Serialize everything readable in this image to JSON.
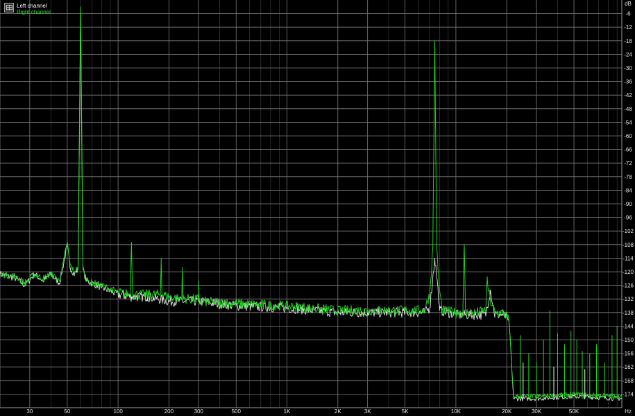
{
  "chart_data": {
    "type": "line",
    "x_scale": "log",
    "xlim_hz": [
      20,
      96000
    ],
    "ylim_db": [
      -180,
      0
    ],
    "grid": true,
    "x_unit_label": "Hz",
    "y_unit_label": "dB",
    "x_ticks": [
      {
        "value": 20,
        "label": ""
      },
      {
        "value": 30,
        "label": "30"
      },
      {
        "value": 50,
        "label": "50"
      },
      {
        "value": 100,
        "label": "100"
      },
      {
        "value": 200,
        "label": "200"
      },
      {
        "value": 300,
        "label": "300"
      },
      {
        "value": 500,
        "label": "500"
      },
      {
        "value": 1000,
        "label": "1K"
      },
      {
        "value": 2000,
        "label": "2K"
      },
      {
        "value": 3000,
        "label": "3K"
      },
      {
        "value": 5000,
        "label": "5K"
      },
      {
        "value": 10000,
        "label": "10K"
      },
      {
        "value": 20000,
        "label": "20K"
      },
      {
        "value": 30000,
        "label": "30K"
      },
      {
        "value": 50000,
        "label": "50K"
      }
    ],
    "x_minor_ticks": [
      40,
      60,
      70,
      80,
      90,
      400,
      600,
      700,
      800,
      900,
      4000,
      6000,
      7000,
      8000,
      9000,
      40000,
      60000,
      70000,
      80000,
      90000
    ],
    "y_ticks": [
      -6,
      -12,
      -18,
      -24,
      -30,
      -36,
      -42,
      -48,
      -54,
      -60,
      -66,
      -72,
      -78,
      -84,
      -90,
      -96,
      -102,
      -108,
      -114,
      -120,
      -126,
      -132,
      -138,
      -144,
      -150,
      -156,
      -162,
      -168,
      -174
    ],
    "series": [
      {
        "name": "Left channel",
        "color": "#ffffff",
        "points": [
          [
            20,
            -121
          ],
          [
            25,
            -123
          ],
          [
            28,
            -126
          ],
          [
            32,
            -121
          ],
          [
            36,
            -124
          ],
          [
            40,
            -121
          ],
          [
            45,
            -125
          ],
          [
            48,
            -115
          ],
          [
            50,
            -108
          ],
          [
            52,
            -118
          ],
          [
            55,
            -121
          ],
          [
            58,
            -119
          ],
          [
            60,
            -6
          ],
          [
            62,
            -119
          ],
          [
            65,
            -124
          ],
          [
            80,
            -127
          ],
          [
            100,
            -130
          ],
          [
            120,
            -131
          ],
          [
            150,
            -131
          ],
          [
            200,
            -133
          ],
          [
            300,
            -133
          ],
          [
            500,
            -135
          ],
          [
            1000,
            -136
          ],
          [
            2000,
            -138
          ],
          [
            3000,
            -138
          ],
          [
            5000,
            -138
          ],
          [
            6500,
            -138
          ],
          [
            7000,
            -136
          ],
          [
            7500,
            -114
          ],
          [
            7800,
            -126
          ],
          [
            8000,
            -137
          ],
          [
            10000,
            -139
          ],
          [
            13000,
            -139
          ],
          [
            15000,
            -139
          ],
          [
            16000,
            -128
          ],
          [
            17000,
            -139
          ],
          [
            19000,
            -139
          ],
          [
            20500,
            -141
          ],
          [
            21000,
            -150
          ],
          [
            21500,
            -165
          ],
          [
            22000,
            -176
          ],
          [
            30000,
            -176
          ],
          [
            50000,
            -175
          ],
          [
            96000,
            -176
          ]
        ]
      },
      {
        "name": "Right channel",
        "color": "#22dd22",
        "points": [
          [
            20,
            -121
          ],
          [
            25,
            -122
          ],
          [
            28,
            -125
          ],
          [
            32,
            -121
          ],
          [
            36,
            -123
          ],
          [
            40,
            -121
          ],
          [
            45,
            -124
          ],
          [
            48,
            -114
          ],
          [
            50,
            -107
          ],
          [
            52,
            -117
          ],
          [
            55,
            -120
          ],
          [
            58,
            -118
          ],
          [
            60,
            -3
          ],
          [
            62,
            -118
          ],
          [
            65,
            -124
          ],
          [
            80,
            -126
          ],
          [
            100,
            -129
          ],
          [
            118,
            -130
          ],
          [
            120,
            -107
          ],
          [
            122,
            -130
          ],
          [
            150,
            -130
          ],
          [
            178,
            -130
          ],
          [
            180,
            -114
          ],
          [
            182,
            -130
          ],
          [
            200,
            -131
          ],
          [
            238,
            -132
          ],
          [
            240,
            -118
          ],
          [
            242,
            -132
          ],
          [
            300,
            -132
          ],
          [
            298,
            -133
          ],
          [
            300,
            -124
          ],
          [
            302,
            -133
          ],
          [
            500,
            -134
          ],
          [
            1000,
            -135
          ],
          [
            2000,
            -137
          ],
          [
            3000,
            -137
          ],
          [
            5000,
            -137
          ],
          [
            6500,
            -137
          ],
          [
            7000,
            -130
          ],
          [
            7300,
            -110
          ],
          [
            7500,
            -18
          ],
          [
            7700,
            -110
          ],
          [
            8000,
            -128
          ],
          [
            8300,
            -137
          ],
          [
            10000,
            -138
          ],
          [
            11000,
            -138
          ],
          [
            11200,
            -108
          ],
          [
            11400,
            -138
          ],
          [
            13000,
            -138
          ],
          [
            15000,
            -137
          ],
          [
            15300,
            -124
          ],
          [
            16000,
            -133
          ],
          [
            17000,
            -138
          ],
          [
            19000,
            -138
          ],
          [
            20500,
            -140
          ],
          [
            21000,
            -150
          ],
          [
            21500,
            -165
          ],
          [
            22000,
            -175
          ],
          [
            30000,
            -175
          ],
          [
            50000,
            -174
          ],
          [
            96000,
            -175
          ]
        ]
      }
    ],
    "spurs": [
      {
        "series": 1,
        "hz": 24000,
        "db": -148
      },
      {
        "series": 1,
        "hz": 27000,
        "db": -156
      },
      {
        "series": 1,
        "hz": 30000,
        "db": -160
      },
      {
        "series": 1,
        "hz": 33000,
        "db": -150
      },
      {
        "series": 1,
        "hz": 36000,
        "db": -137
      },
      {
        "series": 1,
        "hz": 40000,
        "db": -147
      },
      {
        "series": 1,
        "hz": 44000,
        "db": -152
      },
      {
        "series": 1,
        "hz": 48000,
        "db": -146
      },
      {
        "series": 1,
        "hz": 52000,
        "db": -150
      },
      {
        "series": 1,
        "hz": 56000,
        "db": -155
      },
      {
        "series": 1,
        "hz": 62000,
        "db": -156
      },
      {
        "series": 1,
        "hz": 68000,
        "db": -152
      },
      {
        "series": 1,
        "hz": 76000,
        "db": -160
      },
      {
        "series": 1,
        "hz": 84000,
        "db": -148
      },
      {
        "series": 1,
        "hz": 90000,
        "db": -144
      },
      {
        "series": 0,
        "hz": 25000,
        "db": -160
      },
      {
        "series": 0,
        "hz": 38000,
        "db": -162
      },
      {
        "series": 0,
        "hz": 58000,
        "db": -163
      }
    ]
  },
  "legend": {
    "items": [
      {
        "label": "Left channel",
        "color": "#ffffff"
      },
      {
        "label": "Right channel",
        "color": "#22dd22"
      }
    ]
  },
  "colors": {
    "background": "#000000",
    "grid": "#7d7d7d",
    "frame": "#9a9a9a"
  },
  "icon": "chart-settings-icon"
}
